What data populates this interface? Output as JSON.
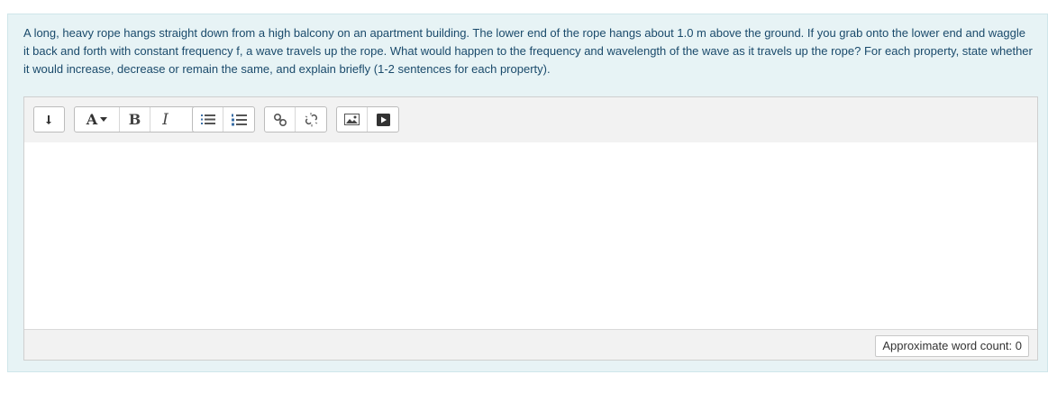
{
  "question": {
    "text": "A long, heavy rope hangs straight down from a high balcony on an apartment building. The lower end of the rope hangs about 1.0 m above the ground. If you grab onto the lower end and waggle it back and forth with constant frequency f, a wave travels up the rope. What would happen to the frequency and wavelength of the wave as it travels up the rope? For each property, state whether it would increase, decrease or remain the same, and explain briefly (1-2 sentences for each property)."
  },
  "toolbar": {
    "buttons": [
      {
        "name": "show-more-buttons",
        "icon": "arrow-down-icon"
      },
      {
        "name": "font-color",
        "icon": "font-color-icon",
        "label": "A"
      },
      {
        "name": "bold",
        "icon": "bold-icon",
        "label": "B"
      },
      {
        "name": "italic",
        "icon": "italic-icon",
        "label": "I"
      },
      {
        "name": "unordered-list",
        "icon": "bullet-list-icon"
      },
      {
        "name": "ordered-list",
        "icon": "numbered-list-icon"
      },
      {
        "name": "link",
        "icon": "link-icon"
      },
      {
        "name": "unlink",
        "icon": "unlink-icon"
      },
      {
        "name": "image",
        "icon": "image-icon"
      },
      {
        "name": "media",
        "icon": "media-icon"
      }
    ],
    "font_label": "A",
    "bold_label": "B",
    "italic_label": "I"
  },
  "editor": {
    "content": ""
  },
  "footer": {
    "word_count": "Approximate word count: 0"
  }
}
